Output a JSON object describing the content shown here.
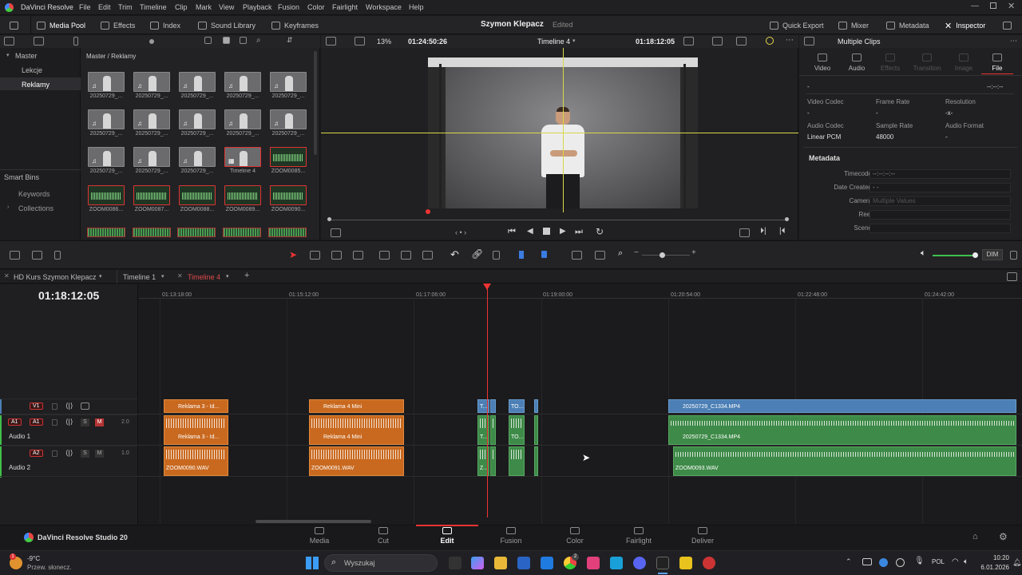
{
  "app": {
    "title": "DaVinci Resolve"
  },
  "menu": [
    "File",
    "Edit",
    "Trim",
    "Timeline",
    "Clip",
    "Mark",
    "View",
    "Playback",
    "Fusion",
    "Color",
    "Fairlight",
    "Workspace",
    "Help"
  ],
  "toolbar": {
    "media_pool": "Media Pool",
    "effects": "Effects",
    "index": "Index",
    "sound_library": "Sound Library",
    "keyframes": "Keyframes",
    "project_name": "Szymon Klepacz",
    "status": "Edited",
    "quick_export": "Quick Export",
    "mixer": "Mixer",
    "metadata": "Metadata",
    "inspector": "Inspector"
  },
  "bins": {
    "master": "Master",
    "items": [
      "Lekcje",
      "Reklamy"
    ],
    "smart_bins": "Smart Bins",
    "smart_items": [
      "Keywords",
      "Collections"
    ]
  },
  "pool": {
    "breadcrumb": "Master / Reklamy",
    "thumbs": [
      {
        "label": "20250729_...",
        "kind": "video"
      },
      {
        "label": "20250729_...",
        "kind": "video"
      },
      {
        "label": "20250729_...",
        "kind": "video"
      },
      {
        "label": "20250729_...",
        "kind": "video"
      },
      {
        "label": "20250729_...",
        "kind": "video"
      },
      {
        "label": "20250729_...",
        "kind": "video"
      },
      {
        "label": "20250729_...",
        "kind": "video"
      },
      {
        "label": "20250729_...",
        "kind": "video"
      },
      {
        "label": "20250729_...",
        "kind": "video"
      },
      {
        "label": "20250729_...",
        "kind": "video"
      },
      {
        "label": "20250729_...",
        "kind": "video"
      },
      {
        "label": "20250729_...",
        "kind": "video"
      },
      {
        "label": "20250729_...",
        "kind": "video"
      },
      {
        "label": "Timeline 4",
        "kind": "timeline"
      },
      {
        "label": "ZOOM0085...",
        "kind": "audio"
      },
      {
        "label": "ZOOM0086...",
        "kind": "audio"
      },
      {
        "label": "ZOOM0087...",
        "kind": "audio"
      },
      {
        "label": "ZOOM0088...",
        "kind": "audio"
      },
      {
        "label": "ZOOM0089...",
        "kind": "audio"
      },
      {
        "label": "ZOOM0090...",
        "kind": "audio"
      }
    ]
  },
  "viewer": {
    "zoom": "13%",
    "source_tc": "01:24:50:26",
    "timeline_name": "Timeline 4",
    "record_tc": "01:18:12:05"
  },
  "inspector": {
    "title": "Multiple Clips",
    "tabs": [
      {
        "label": "Video",
        "active": false,
        "dim": false
      },
      {
        "label": "Audio",
        "active": false,
        "dim": false
      },
      {
        "label": "Effects",
        "active": false,
        "dim": true
      },
      {
        "label": "Transition",
        "active": false,
        "dim": true
      },
      {
        "label": "Image",
        "active": false,
        "dim": true
      },
      {
        "label": "File",
        "active": true,
        "dim": false
      }
    ],
    "name_value": "-",
    "tc_value": "--:--:--",
    "video_codec_label": "Video Codec",
    "frame_rate_label": "Frame Rate",
    "resolution_label": "Resolution",
    "video_codec": "-",
    "frame_rate": "-",
    "resolution": "-x-",
    "audio_codec_label": "Audio Codec",
    "sample_rate_label": "Sample Rate",
    "audio_format_label": "Audio Format",
    "audio_codec": "Linear PCM",
    "sample_rate": "48000",
    "audio_format": "-",
    "metadata_header": "Metadata",
    "fields": [
      {
        "label": "Timecode",
        "value": "--:--:--:--"
      },
      {
        "label": "Date Created",
        "value": "-  -"
      },
      {
        "label": "Camera",
        "value": "Multiple Values"
      },
      {
        "label": "Reel",
        "value": ""
      },
      {
        "label": "Scene",
        "value": ""
      },
      {
        "label": "Shot",
        "value": ""
      }
    ]
  },
  "edit_toolbar": {
    "dim": "DIM"
  },
  "timeline_tabs": [
    "HD Kurs Szymon Klepacz",
    "Timeline 1",
    "Timeline 4"
  ],
  "timecode": "01:18:12:05",
  "ruler": [
    "01:13:18:00",
    "01:15:12:00",
    "01:17:06:00",
    "01:19:00:00",
    "01:20:54:00",
    "01:22:48:00",
    "01:24:42:00"
  ],
  "tracks": {
    "v1": "V1",
    "a1": "A1",
    "a1_name": "Audio 1",
    "a1_level": "2.0",
    "a2": "A2",
    "a2_name": "Audio 2",
    "a2_level": "1.0",
    "solo": "S",
    "mute": "M"
  },
  "clips": {
    "v1_a": "Reklama 3 - Id...",
    "v1_b": "Reklama 4 Mini",
    "v1_c": "T...",
    "v1_d": "TO...",
    "v1_e": "20250729_C1334.MP4",
    "a1_a": "Reklama 3 - Id...",
    "a1_b": "Reklama 4 Mini",
    "a1_c": "T...",
    "a1_d": "TO...",
    "a1_e": "20250729_C1334.MP4",
    "a2_a": "ZOOM0090.WAV",
    "a2_b": "ZOOM0091.WAV",
    "a2_c": "Z...",
    "a2_e": "ZOOM0093.WAV"
  },
  "pages": [
    {
      "label": "Media",
      "active": false
    },
    {
      "label": "Cut",
      "active": false
    },
    {
      "label": "Edit",
      "active": true
    },
    {
      "label": "Fusion",
      "active": false
    },
    {
      "label": "Color",
      "active": false
    },
    {
      "label": "Fairlight",
      "active": false
    },
    {
      "label": "Deliver",
      "active": false
    }
  ],
  "brand": "DaVinci Resolve Studio 20",
  "taskbar": {
    "temp": "-9°C",
    "weather": "Przew. słonecz.",
    "search": "Wyszukaj",
    "lang": "POL",
    "time": "10:20",
    "date": "6.01.2026",
    "chrome_badge": "2"
  }
}
